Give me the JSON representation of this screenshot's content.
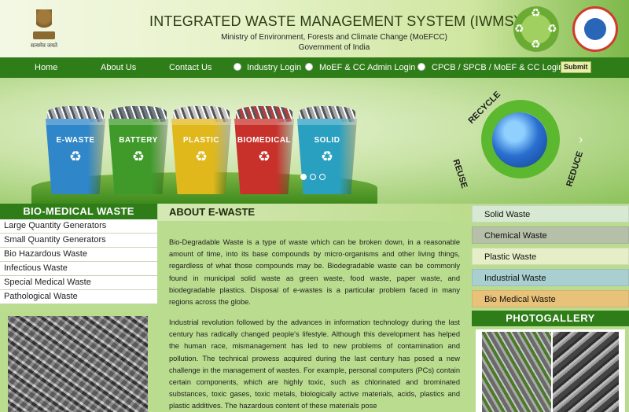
{
  "header": {
    "title": "INTEGRATED WASTE MANAGEMENT SYSTEM (IWMS)",
    "ministry": "Ministry of Environment, Forests and Climate Change (MoEFCC)",
    "government": "Government of India",
    "emblem_motto": "सत्यमेव जयते"
  },
  "nav": {
    "home": "Home",
    "about": "About Us",
    "contact": "Contact Us",
    "logins": [
      "Industry Login",
      "MoEF & CC Admin Login",
      "CPCB / SPCB / MoEF & CC Login"
    ],
    "submit": "Submit"
  },
  "banner": {
    "bins": [
      {
        "label": "E-WASTE",
        "color": "#2f86c8"
      },
      {
        "label": "BATTERY",
        "color": "#3f9a2a"
      },
      {
        "label": "PLASTIC",
        "color": "#e0b81c"
      },
      {
        "label": "BIOMEDICAL",
        "color": "#c8302a"
      },
      {
        "label": "SOLID",
        "color": "#2aa0c0"
      }
    ],
    "cycle_words": {
      "recycle": "RECYCLE",
      "reuse": "REUSE",
      "reduce": "REDUCE"
    },
    "slide_index": 1,
    "slide_count": 3
  },
  "left": {
    "heading": "BIO-MEDICAL WASTE",
    "items": [
      "Large Quantity Generators",
      "Small Quantity Generators",
      "Bio Hazardous Waste",
      "Infectious Waste",
      "Special Medical Waste",
      "Pathological Waste"
    ]
  },
  "center": {
    "heading": "ABOUT E-WASTE",
    "para1": "Bio-Degradable Waste is a type of waste which can be broken down, in a reasonable amount of time, into its base compounds by micro-organisms and other living things, regardless of what those compounds may be. Biodegradable waste can be commonly found in municipal solid waste as green waste, food waste, paper waste, and biodegradable plastics. Disposal of e-wastes is a particular problem faced in many regions across the globe.",
    "para2": "Industrial revolution followed by the advances in information technology during the last century has radically changed people's lifestyle. Although this development has helped the human race, mismanagement has led to new problems of contamination and pollution. The technical prowess acquired during the last century has posed a new challenge in the management of wastes. For example, personal computers (PCs) contain certain components, which are highly toxic, such as chlorinated and brominated substances, toxic gases, toxic metals, biologically active materials, acids, plastics and plastic additives. The hazardous content of these materials pose"
  },
  "right": {
    "items": [
      {
        "label": "Solid Waste",
        "color": "#d7e9d2"
      },
      {
        "label": "Chemical Waste",
        "color": "#b6bfa8"
      },
      {
        "label": "Plastic Waste",
        "color": "#e6eec8"
      },
      {
        "label": "Industrial Waste",
        "color": "#a9cfd0"
      },
      {
        "label": "Bio Medical Waste",
        "color": "#e9c27a"
      }
    ],
    "gallery_heading": "PHOTOGALLERY"
  }
}
